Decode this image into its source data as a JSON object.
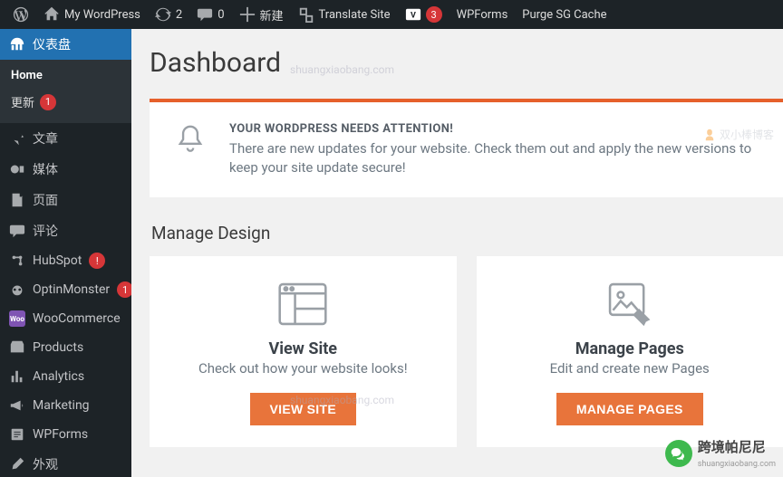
{
  "adminbar": {
    "site_name": "My WordPress",
    "updates_count": "2",
    "comments_count": "0",
    "new_label": "新建",
    "translate_label": "Translate Site",
    "vd_count": "3",
    "wpforms_label": "WPForms",
    "purge_label": "Purge SG Cache"
  },
  "sidebar": {
    "dashboard": "仪表盘",
    "home": "Home",
    "updates": "更新",
    "updates_count": "1",
    "posts": "文章",
    "media": "媒体",
    "pages": "页面",
    "comments": "评论",
    "hubspot": "HubSpot",
    "hubspot_badge": "!",
    "optinmonster": "OptinMonster",
    "optinmonster_badge": "1",
    "woocommerce": "WooCommerce",
    "products": "Products",
    "analytics": "Analytics",
    "marketing": "Marketing",
    "wpforms": "WPForms",
    "appearance": "外观"
  },
  "page": {
    "title": "Dashboard",
    "notice_title": "YOUR WORDPRESS NEEDS ATTENTION!",
    "notice_body": "There are new updates for your website. Check them out and apply the new versions to keep your site update secure!",
    "manage_design": "Manage Design",
    "card1_title": "View Site",
    "card1_desc": "Check out how your website looks!",
    "card1_btn": "VIEW SITE",
    "card2_title": "Manage Pages",
    "card2_desc": "Edit and create new Pages",
    "card2_btn": "MANAGE PAGES"
  },
  "watermark": {
    "domain": "shuangxiaobang.com",
    "brand": "跨境帕尼尼",
    "brand_sub": "shuangxiaobang.com",
    "side": "双小棒博客"
  }
}
